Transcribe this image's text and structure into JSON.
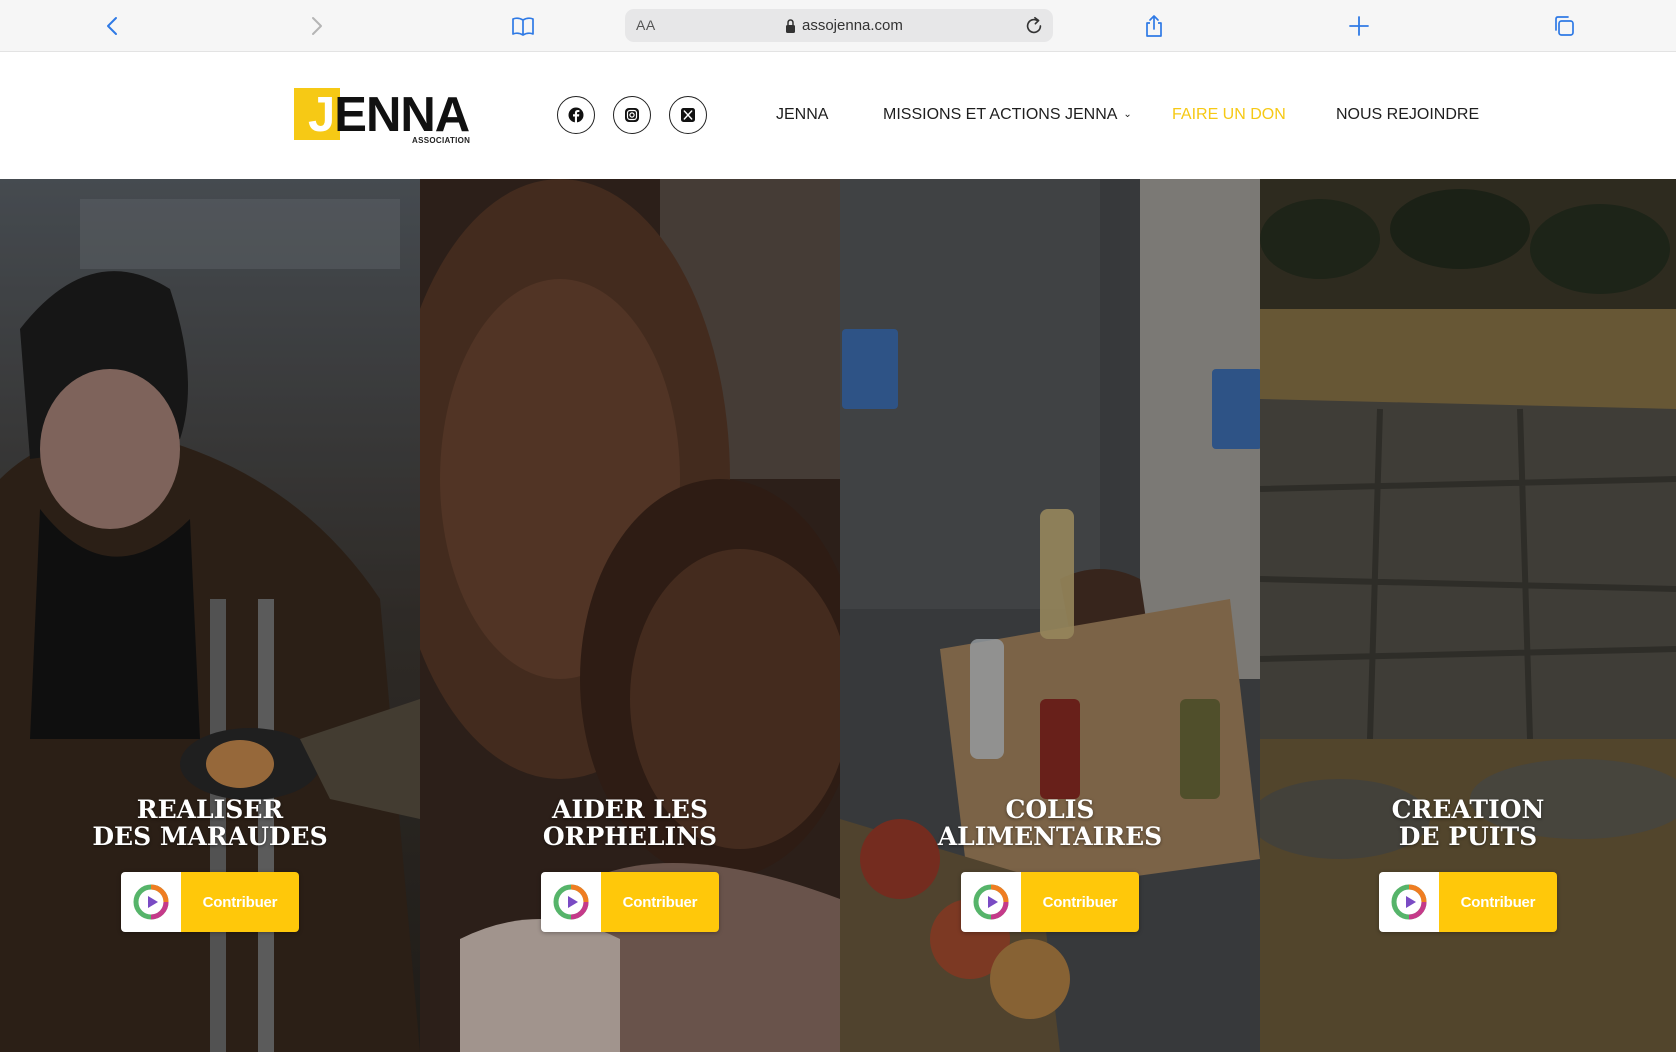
{
  "browser": {
    "text_size": "AA",
    "url": "assojenna.com"
  },
  "header": {
    "logo": {
      "mark": "J",
      "name": "ENNA",
      "subtitle": "ASSOCIATION"
    },
    "social": [
      "facebook-icon",
      "instagram-icon",
      "x-icon"
    ],
    "nav": {
      "home": "JENNA",
      "missions": "MISSIONS ET ACTIONS JENNA",
      "donate": "FAIRE UN DON",
      "join": "NOUS REJOINDRE"
    },
    "accent_color": "#f6c915"
  },
  "panels": [
    {
      "title_line1": "REALISER",
      "title_line2": "DES MARAUDES",
      "button": "Contribuer"
    },
    {
      "title_line1": "AIDER LES",
      "title_line2": "ORPHELINS",
      "button": "Contribuer"
    },
    {
      "title_line1": "COLIS",
      "title_line2": "ALIMENTAIRES",
      "button": "Contribuer"
    },
    {
      "title_line1": "CREATION",
      "title_line2": "DE PUITS",
      "button": "Contribuer"
    }
  ],
  "button_color": "#ffc80a"
}
